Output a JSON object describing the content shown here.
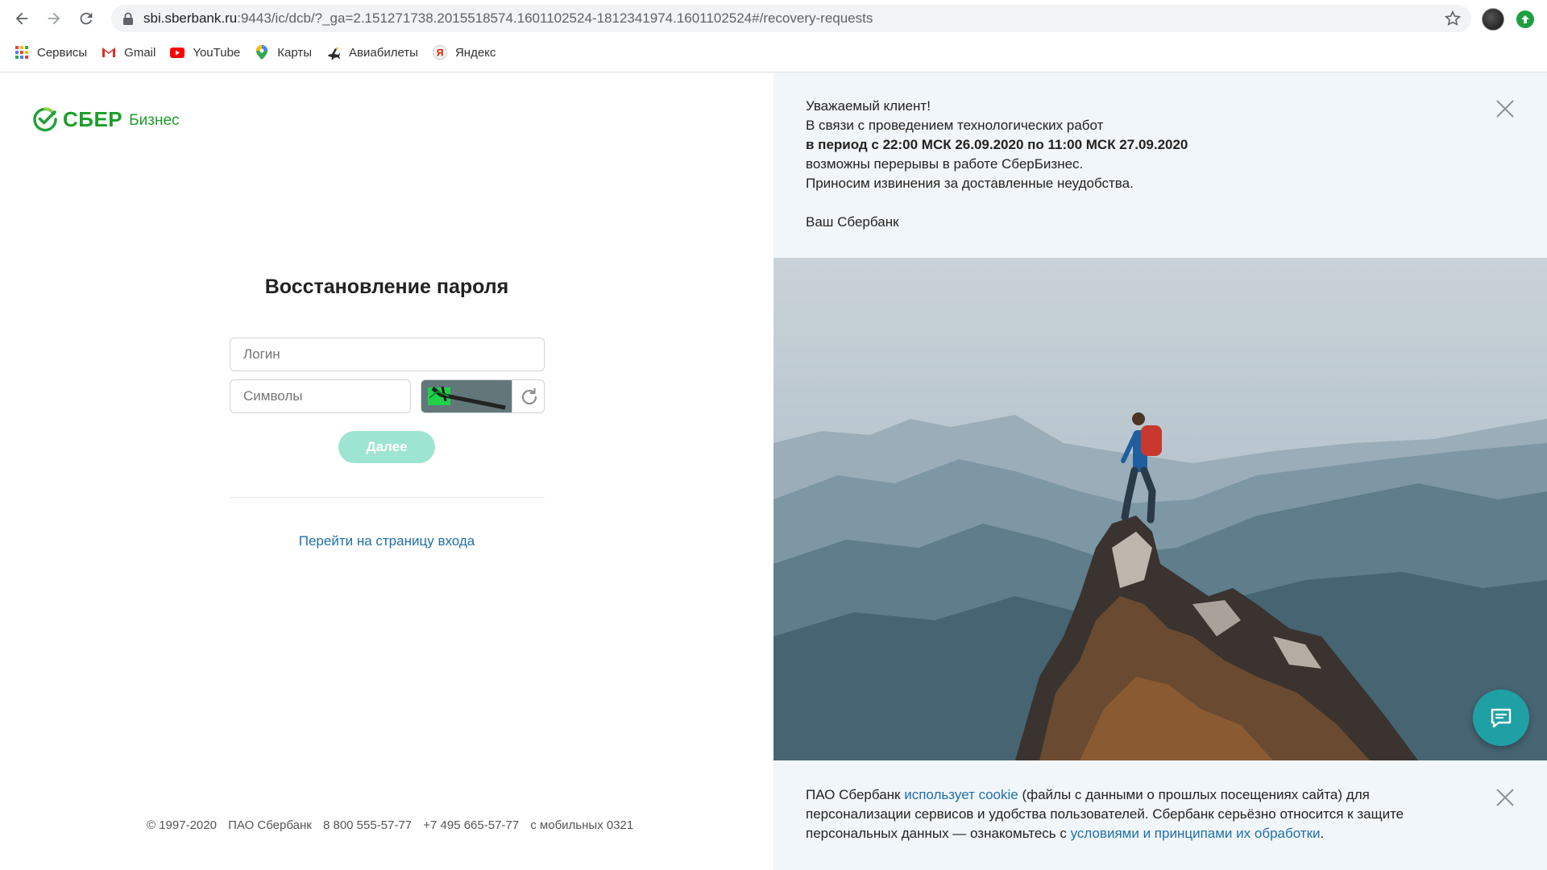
{
  "browser": {
    "url_host": "sbi.sberbank.ru",
    "url_rest": ":9443/ic/dcb/?_ga=2.151271738.2015518574.1601102524-1812341974.1601102524#/recovery-requests",
    "bookmarks": [
      {
        "label": "Сервисы",
        "icon": "apps-grid-icon"
      },
      {
        "label": "Gmail",
        "icon": "gmail-icon"
      },
      {
        "label": "YouTube",
        "icon": "youtube-icon"
      },
      {
        "label": "Карты",
        "icon": "maps-pin-icon"
      },
      {
        "label": "Авиабилеты",
        "icon": "plane-icon"
      },
      {
        "label": "Яндекс",
        "icon": "yandex-icon"
      }
    ]
  },
  "logo": {
    "brand": "СБЕР",
    "product": "Бизнес"
  },
  "form": {
    "title": "Восстановление пароля",
    "login_placeholder": "Логин",
    "symbols_placeholder": "Символы",
    "next_label": "Далее",
    "login_link": "Перейти на страницу входа"
  },
  "footer": {
    "copyright": "© 1997-2020",
    "company": "ПАО Сбербанк",
    "phone1": "8 800 555-57-77",
    "phone2": "+7 495 665-57-77",
    "mobile": "с мобильных 0321"
  },
  "notice": {
    "line1": "Уважаемый клиент!",
    "line2": "В связи с проведением технологических работ",
    "line3": "в период с 22:00 МСК 26.09.2020 по 11:00 МСК 27.09.2020",
    "line4": "возможны перерывы в работе СберБизнес.",
    "line5": "Приносим извинения за доставленные неудобства.",
    "signature": "Ваш Сбербанк"
  },
  "cookie": {
    "part1": "ПАО Сбербанк ",
    "link1": "использует cookie",
    "part2": " (файлы с данными о прошлых посещениях сайта) для персонализации сервисов и удобства пользователей. Сбербанк серьёзно относится к защите персональных данных — ознакомьтесь с ",
    "link2": "условиями и принципами их обработки",
    "part3": "."
  },
  "colors": {
    "brand_green": "#1a9f29",
    "button_disabled": "#9ee4d2",
    "link": "#1f6fa8",
    "chat": "#1fa0a4"
  }
}
